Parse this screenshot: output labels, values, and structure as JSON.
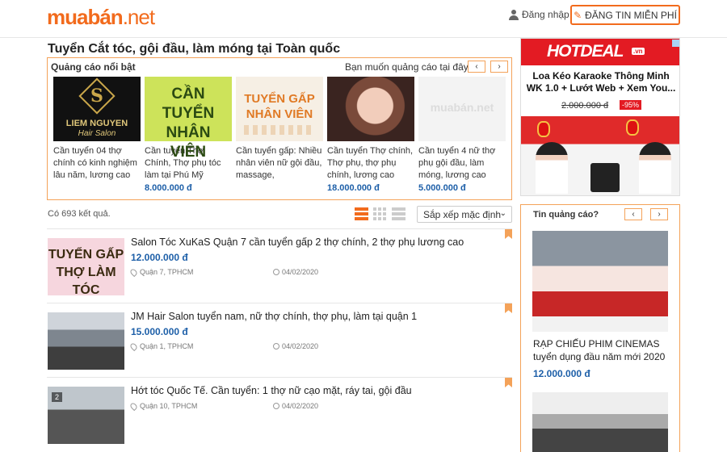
{
  "header": {
    "logo_main": "muabán",
    "logo_tld": ".net",
    "login_label": "Đăng nhập",
    "post_button_label": "ĐĂNG TIN MIỄN PHÍ",
    "icons": [
      "user-icon",
      "pencil-icon"
    ]
  },
  "page": {
    "title": "Tuyển Cắt tóc, gội đầu, làm móng tại Toàn quốc"
  },
  "featured": {
    "heading": "Quảng cáo nổi bật",
    "ask": "Bạn muốn quảng cáo tại đây?",
    "prev_icon": "chevron-left-icon",
    "next_icon": "chevron-right-icon",
    "cards": [
      {
        "image_lines": [
          "LIEM NGUYEN",
          "Hair Salon"
        ],
        "image_letter": "S",
        "text": "Cần tuyển 04 thợ chính có kinh nghiệm lâu năm, lương cao",
        "price": ""
      },
      {
        "image_lines": [
          "CẦN TUYỂN",
          "NHÂN VIÊN"
        ],
        "text": "Cần tuyển Thợ Chính, Thợ phụ tóc làm tại Phú Mỹ",
        "price": "8.000.000 đ"
      },
      {
        "image_lines": [
          "TUYỂN GẤP",
          "NHÂN VIÊN"
        ],
        "text": "Cần tuyển gấp: Nhiều nhân viên nữ gội đầu, massage,",
        "price": ""
      },
      {
        "image_lines": [],
        "text": "Cần tuyển Thợ chính, Thợ phụ, thợ phụ chính, lương cao",
        "price": "18.000.000 đ"
      },
      {
        "image_lines": [
          "muabán.net"
        ],
        "text": "Cần tuyển 4 nữ thợ phụ gội đầu, làm móng, lương cao",
        "price": "5.000.000 đ"
      }
    ]
  },
  "results": {
    "count_text": "Có 693 kết quả.",
    "sort_label": "Sắp xếp mặc định",
    "view_icons": [
      "list-view-icon",
      "grid-view-icon",
      "compact-view-icon"
    ]
  },
  "listings": [
    {
      "title": "Salon Tóc XuKaS Quận 7 cần tuyển gấp 2 thợ chính, 2 thợ phụ lương cao",
      "price": "12.000.000 đ",
      "location": "Quận 7, TPHCM",
      "date": "04/02/2020",
      "image_lines": [
        "TUYỂN GẤP",
        "THỢ LÀM TÓC"
      ]
    },
    {
      "title": "JM Hair Salon tuyển nam, nữ thợ chính, thợ phụ, làm tại quận 1",
      "price": "15.000.000 đ",
      "location": "Quận 1, TPHCM",
      "date": "04/02/2020",
      "image_lines": []
    },
    {
      "title": "Hớt tóc Quốc Tế. Cần tuyển: 1 thợ nữ cạo mặt, ráy tai, gội đầu",
      "price": "",
      "location": "Quận 10, TPHCM",
      "date": "04/02/2020",
      "image_badge": "2"
    }
  ],
  "hotdeal": {
    "logo": "HOTDEAL",
    "logo_suffix": ".vn",
    "title": "Loa Kéo Karaoke Thông Minh WK 1.0 + Lướt Web + Xem You...",
    "old_price": "2.000.000 đ",
    "discount": "-95%"
  },
  "tin_qc": {
    "heading": "Tin quảng cáo?",
    "item_title": "RẠP CHIẾU PHIM CINEMAS tuyển dụng đầu năm mới 2020",
    "item_price": "12.000.000 đ"
  },
  "colors": {
    "brand_orange": "#f26b1d",
    "price_blue": "#1d5fa8",
    "hotdeal_red": "#e31b23",
    "border_orange": "#f4a259"
  }
}
